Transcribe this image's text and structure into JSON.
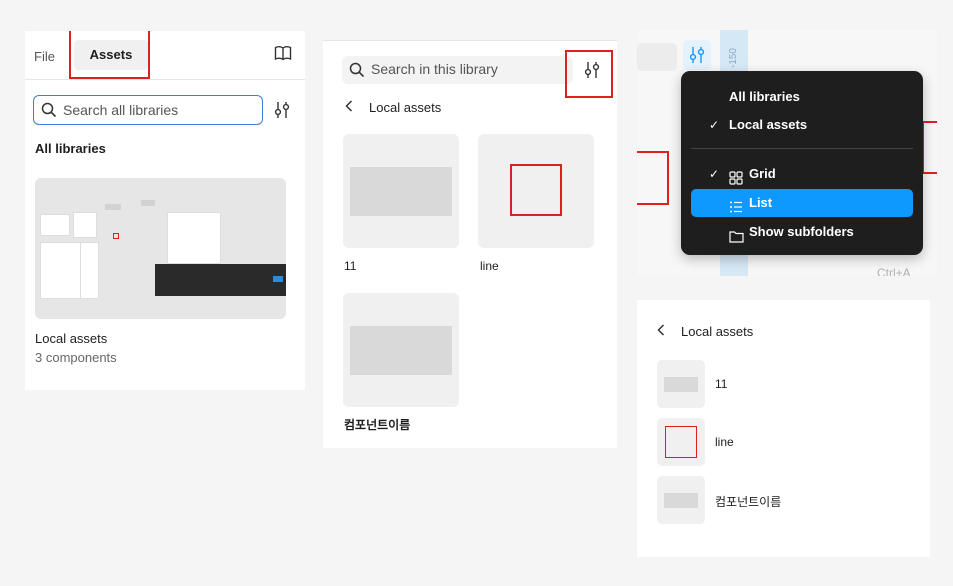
{
  "panel1": {
    "tabs": [
      "File",
      "Assets"
    ],
    "search_placeholder": "Search all libraries",
    "section_title": "All libraries",
    "library": {
      "name": "Local assets",
      "count": "3 components"
    }
  },
  "panel2": {
    "search_placeholder": "Search in this library",
    "back_label": "Local assets",
    "components": [
      "11",
      "line",
      "컴포넌트이름"
    ]
  },
  "panel3": {
    "ruler_label": "-150",
    "shortcut": "Ctrl+A",
    "menu": {
      "items": [
        "All libraries",
        "Local assets",
        "Grid",
        "List",
        "Show subfolders"
      ]
    }
  },
  "panel4": {
    "back_label": "Local assets",
    "components": [
      "11",
      "line",
      "컴포넌트이름"
    ]
  },
  "colors": {
    "highlight": "#e0201f",
    "accent": "#0d99ff",
    "focus": "#3d7bd6"
  }
}
